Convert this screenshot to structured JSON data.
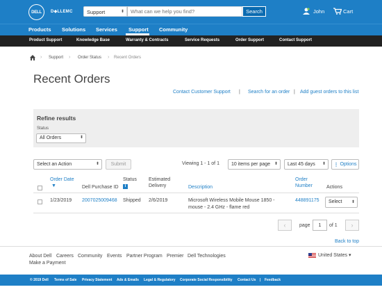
{
  "header": {
    "logo": "DELL",
    "brand_emc": "D◆LLEMC",
    "search_scope": "Support",
    "search_placeholder": "What can we help you find?",
    "search_button": "Search",
    "user_name": "John",
    "cart_label": "Cart"
  },
  "main_nav": [
    "Products",
    "Solutions",
    "Services",
    "Support",
    "Community"
  ],
  "main_nav_active": "Support",
  "sub_nav": [
    "Product Support",
    "Knowledge Base",
    "Warranty & Contracts",
    "Service Requests",
    "Order Support",
    "Contact Support"
  ],
  "breadcrumb": [
    "Support",
    "Order Status",
    "Recent Orders"
  ],
  "page_title": "Recent Orders",
  "top_links": [
    "Contact Customer Support",
    "Search for an order",
    "Add guest orders to this list"
  ],
  "refine": {
    "title": "Refine results",
    "status_label": "Status",
    "status_value": "All Orders"
  },
  "toolbar": {
    "action_select": "Select an Action",
    "submit": "Submit",
    "viewing": "Viewing 1 - 1 of 1",
    "items_per_page": "10 items per page",
    "date_range": "Last 45 days",
    "options": "Options"
  },
  "table": {
    "headers": {
      "order_date": "Order Date",
      "purchase_id": "Dell Purchase ID",
      "status": "Status",
      "estimated_delivery_1": "Estimated",
      "estimated_delivery_2": "Delivery",
      "description": "Description",
      "order_number_1": "Order",
      "order_number_2": "Number",
      "actions": "Actions"
    },
    "rows": [
      {
        "order_date": "1/23/2019",
        "purchase_id": "2007025009468",
        "status": "Shipped",
        "estimated_delivery": "2/6/2019",
        "description_1": "Microsoft Wireless Mobile Mouse 1850 -",
        "description_2": "mouse - 2.4 GHz - flame red",
        "order_number": "448891175",
        "action": "Select"
      }
    ]
  },
  "pagination": {
    "page_label": "page",
    "page_value": "1",
    "of_label": "of 1"
  },
  "back_to_top": "Back to top",
  "footer": {
    "links": [
      "About Dell",
      "Careers",
      "Community",
      "Events",
      "Partner Program",
      "Premier",
      "Dell Technologies"
    ],
    "link_line2": "Make a Payment",
    "locale": "United States ▾"
  },
  "bottom_bar": [
    "© 2019 Dell",
    "Terms of Sale",
    "Privacy Statement",
    "Ads & Emails",
    "Legal & Regulatory",
    "Corporate Social Responsibility",
    "Contact Us",
    "Feedback"
  ],
  "colors": {
    "brand_blue": "#1e7fc6",
    "subnav_dark": "#222222",
    "panel_gray": "#eeeeee"
  }
}
